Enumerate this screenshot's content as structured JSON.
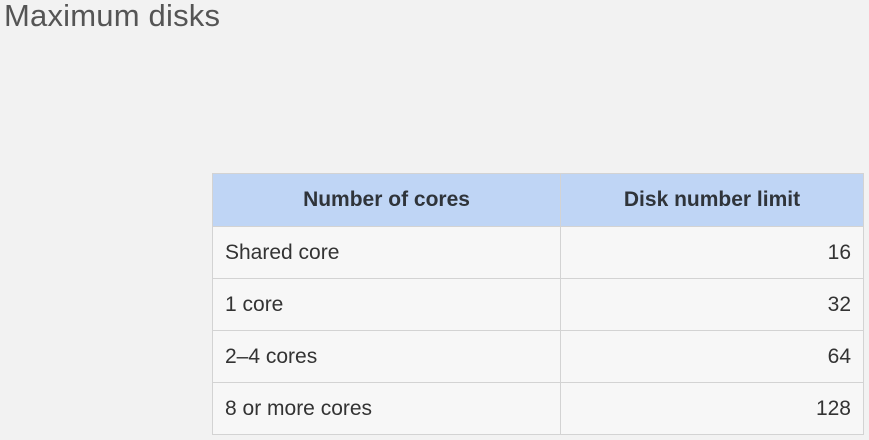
{
  "slide": {
    "title": "Maximum disks"
  },
  "table": {
    "headers": [
      "Number of cores",
      "Disk number limit"
    ],
    "rows": [
      {
        "cores": "Shared core",
        "limit": "16"
      },
      {
        "cores": "1 core",
        "limit": "32"
      },
      {
        "cores": "2–4 cores",
        "limit": "64"
      },
      {
        "cores": "8 or more cores",
        "limit": "128"
      }
    ]
  }
}
